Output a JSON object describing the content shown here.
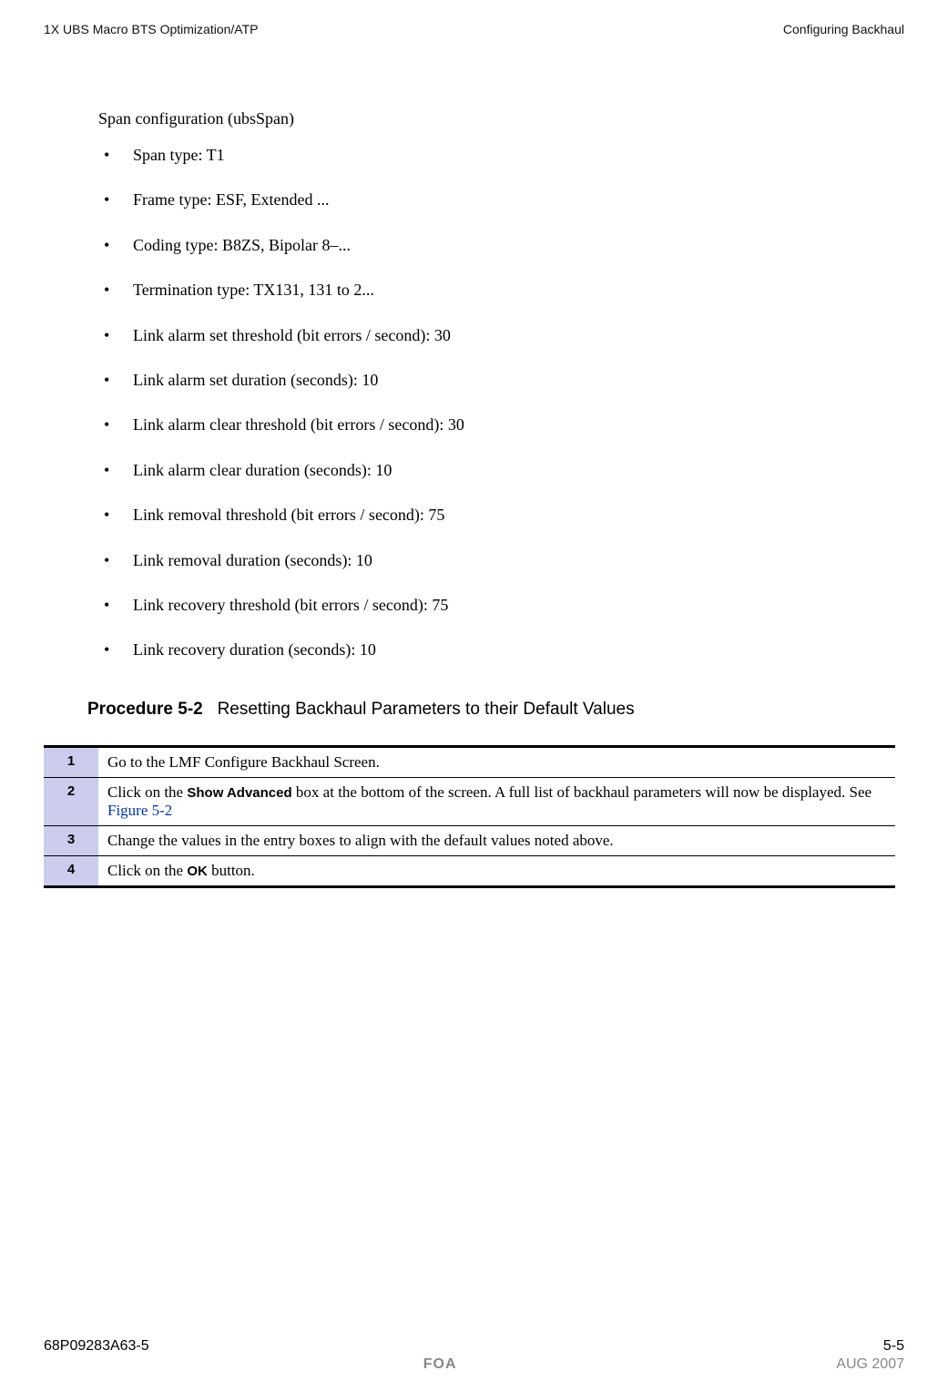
{
  "header": {
    "left": "1X UBS Macro BTS Optimization/ATP",
    "right": "Configuring Backhaul"
  },
  "span_section": {
    "title": "Span configuration (ubsSpan)",
    "items": [
      "Span type: T1",
      "Frame type: ESF, Extended ...",
      "Coding type: B8ZS, Bipolar 8–...",
      "Termination type: TX131, 131 to 2...",
      "Link alarm set threshold (bit errors / second): 30",
      "Link alarm set duration (seconds): 10",
      "Link alarm clear threshold (bit errors / second): 30",
      "Link alarm clear duration (seconds): 10",
      "Link removal threshold (bit errors / second): 75",
      "Link removal duration (seconds): 10",
      "Link recovery threshold (bit errors / second): 75",
      "Link recovery duration (seconds): 10"
    ]
  },
  "procedure": {
    "number": "Procedure 5-2",
    "title": "Resetting Backhaul Parameters to their Default Values",
    "steps": [
      {
        "n": "1",
        "text_pre": "Go to the LMF Configure Backhaul Screen.",
        "bold": "",
        "text_post": "",
        "link": ""
      },
      {
        "n": "2",
        "text_pre": "Click on the ",
        "bold": "Show Advanced",
        "text_post": " box at the bottom of the screen. A full list of backhaul parameters will now be displayed. See ",
        "link": "Figure 5-2"
      },
      {
        "n": "3",
        "text_pre": "Change the values in the entry boxes to align with the default values noted above.",
        "bold": "",
        "text_post": "",
        "link": ""
      },
      {
        "n": "4",
        "text_pre": "Click on the ",
        "bold": "OK",
        "text_post": " button.",
        "link": ""
      }
    ]
  },
  "footer": {
    "doc_number": "68P09283A63-5",
    "page": "5-5",
    "foa": "FOA",
    "date": "AUG 2007"
  }
}
